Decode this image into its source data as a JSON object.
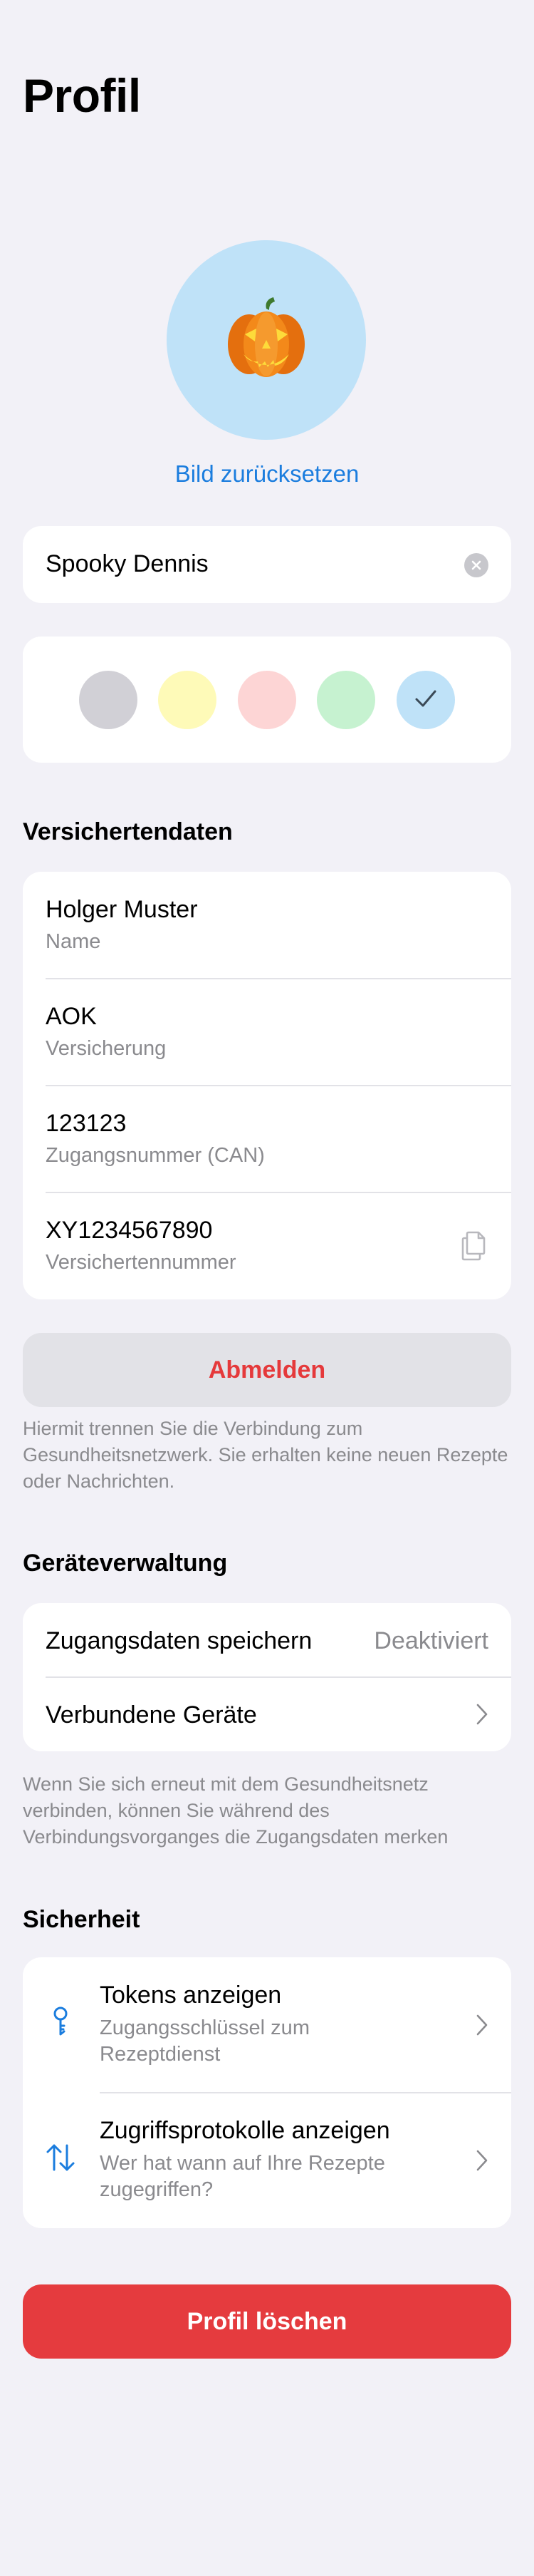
{
  "page": {
    "title": "Profil"
  },
  "avatar": {
    "emoji": "🎃",
    "reset_label": "Bild zurücksetzen"
  },
  "name_field": {
    "value": "Spooky Dennis"
  },
  "color_picker": {
    "options": [
      {
        "name": "grey",
        "color": "#D1D0D6",
        "selected": false
      },
      {
        "name": "yellow",
        "color": "#FEFAB8",
        "selected": false
      },
      {
        "name": "red",
        "color": "#FDD5D5",
        "selected": false
      },
      {
        "name": "green",
        "color": "#C6F2D0",
        "selected": false
      },
      {
        "name": "blue",
        "color": "#BFE2F8",
        "selected": true
      }
    ]
  },
  "insurance": {
    "heading": "Versichertendaten",
    "rows": [
      {
        "value": "Holger Muster",
        "label": "Name"
      },
      {
        "value": "AOK",
        "label": "Versicherung"
      },
      {
        "value": "123123",
        "label": "Zugangsnummer (CAN)"
      },
      {
        "value": "XY1234567890",
        "label": "Versichertennummer"
      }
    ]
  },
  "logout": {
    "label": "Abmelden",
    "footnote": "Hiermit trennen Sie die Verbindung zum Gesundheitsnetzwerk. Sie erhalten keine neuen Rezepte oder Nachrichten."
  },
  "devices": {
    "heading": "Geräteverwaltung",
    "save_credentials_label": "Zugangsdaten speichern",
    "save_credentials_value": "Deaktiviert",
    "connected_devices_label": "Verbundene Geräte",
    "footnote": "Wenn Sie sich erneut mit dem Gesundheitsnetz verbinden, können Sie während des Verbindungsvorganges die Zugangsdaten merken"
  },
  "security": {
    "heading": "Sicherheit",
    "items": [
      {
        "title": "Tokens anzeigen",
        "subtitle": "Zugangsschlüssel zum Rezeptdienst",
        "icon": "key-icon"
      },
      {
        "title": "Zugriffsprotokolle anzeigen",
        "subtitle": "Wer hat wann auf Ihre Rezepte zugegriffen?",
        "icon": "arrows-up-down-icon"
      }
    ]
  },
  "delete": {
    "label": "Profil löschen"
  },
  "colors": {
    "accent": "#1B7DDE",
    "destructive": "#E53B3E",
    "background": "#F2F1F7"
  }
}
